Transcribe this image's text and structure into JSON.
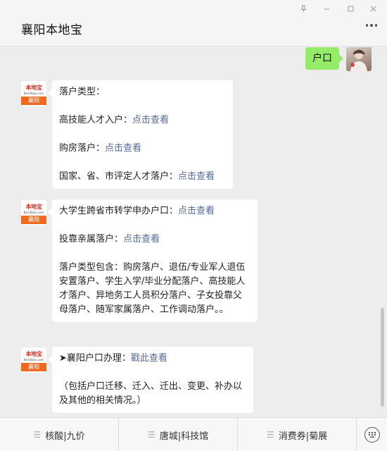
{
  "header": {
    "title": "襄阳本地宝",
    "window_controls": [
      "pin-icon",
      "minimize-icon",
      "maximize-icon",
      "close-icon"
    ],
    "more_icon": "ellipsis-icon"
  },
  "my_message": {
    "text": "户口"
  },
  "avatar_logo": {
    "top": "本地宝",
    "url": "Bendibao.com",
    "city": "襄阳"
  },
  "messages": [
    {
      "lines": [
        {
          "text": "落户类型："
        },
        {
          "text": "高技能人才入户：",
          "link": "点击查看"
        },
        {
          "text": "购房落户：",
          "link": "点击查看"
        },
        {
          "text": "国家、省、市评定人才落户：",
          "link": "点击查看"
        }
      ]
    },
    {
      "lines": [
        {
          "text": "大学生跨省市转学申办户口：",
          "link": "点击查看"
        },
        {
          "text": "投靠亲属落户：",
          "link": "点击查看"
        },
        {
          "text": "落户类型包含：购房落户、退伍/专业军人退伍安置落户、学生入学/毕业分配落户、高技能人才落户、异地务工人员积分落户、子女投靠父母落户、随军家属落户、工作调动落户。。"
        }
      ]
    },
    {
      "lines": [
        {
          "text": "➤襄阳户口办理：",
          "link": "戳此查看"
        },
        {
          "text": "（包括户口迁移、迁入、迁出、变更、补办以及其他的相关情况。）"
        }
      ]
    }
  ],
  "menu": {
    "items": [
      "核酸|九价",
      "唐城|科技馆",
      "消费券|菊展"
    ],
    "keyboard_icon": "keyboard-icon"
  },
  "colors": {
    "link": "#576b95",
    "my_bubble": "#95ec69",
    "logo_orange": "#ee6a1f",
    "background": "#ededed"
  }
}
